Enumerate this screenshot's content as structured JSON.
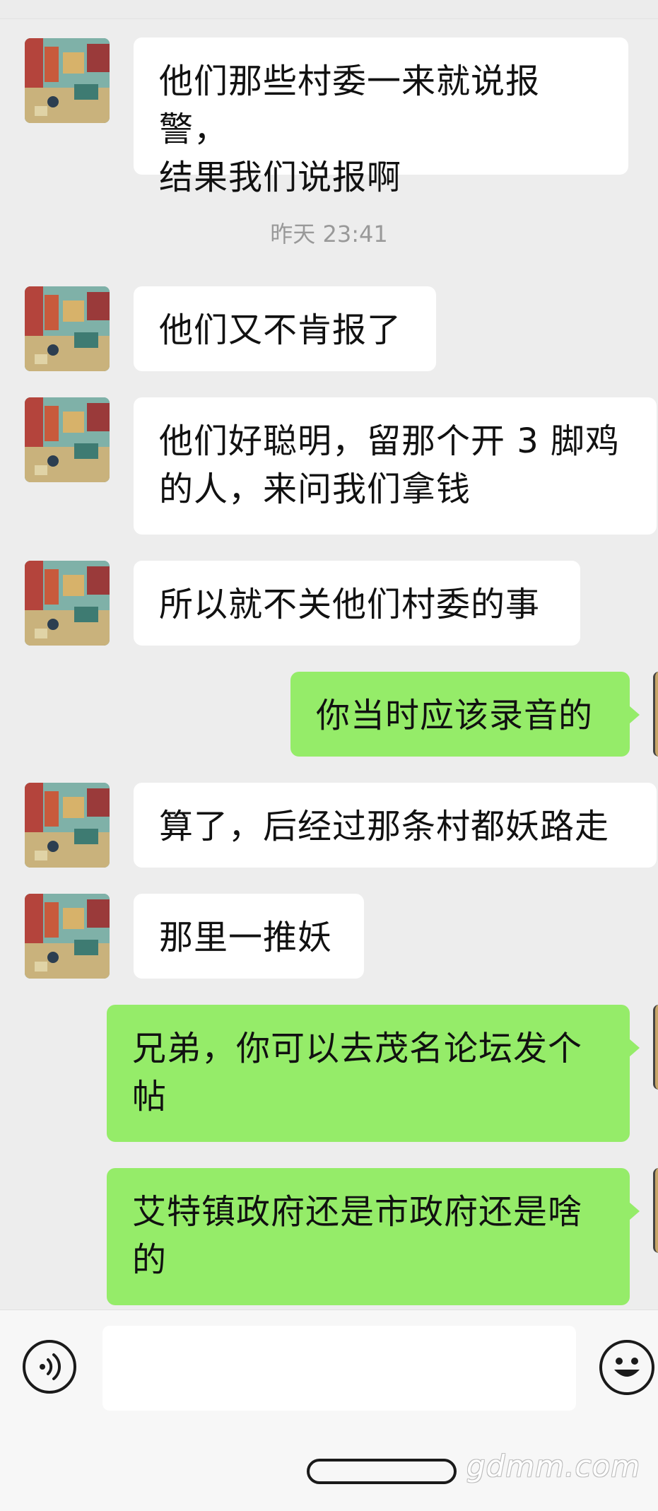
{
  "messages": [
    {
      "side": "in",
      "text": "他们那些村委一来就说报警，\n结果我们说报啊"
    },
    {
      "side": "in",
      "text": "他们又不肯报了"
    },
    {
      "side": "in",
      "text": "他们好聪明，留那个开 3 脚鸡\n的人，来问我们拿钱"
    },
    {
      "side": "in",
      "text": "所以就不关他们村委的事"
    },
    {
      "side": "out",
      "text": "你当时应该录音的"
    },
    {
      "side": "in",
      "text": "算了，后经过那条村都妖路走"
    },
    {
      "side": "in",
      "text": "那里一推妖"
    },
    {
      "side": "out",
      "text": "兄弟，你可以去茂名论坛发个\n帖"
    },
    {
      "side": "out",
      "text": "艾特镇政府还是市政府还是啥\n的"
    }
  ],
  "timestamp": "昨天 23:41",
  "input": {
    "placeholder": ""
  },
  "watermark": "gdmm.com",
  "icons": {
    "voice": "voice-icon",
    "emoji": "emoji-icon"
  },
  "colors": {
    "incoming": "#ffffff",
    "outgoing": "#95ec69",
    "background": "#ededed"
  }
}
